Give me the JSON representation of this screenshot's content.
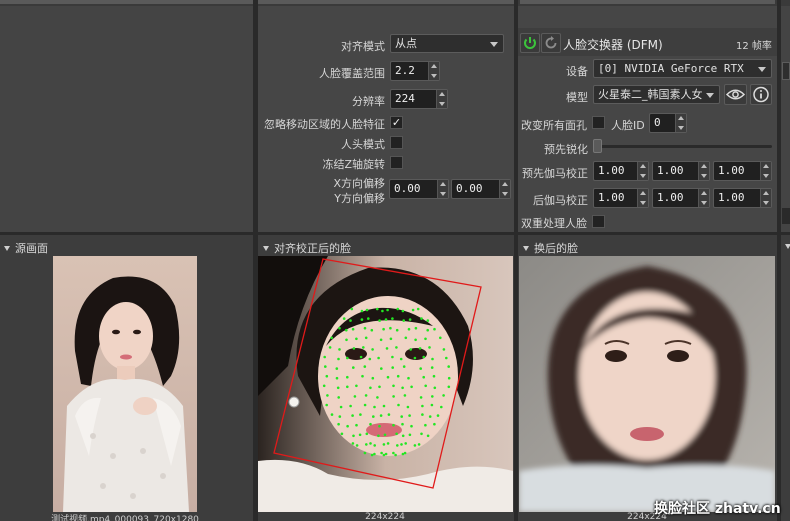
{
  "align_panel": {
    "align_mode_label": "对齐模式",
    "align_mode_value": "从点",
    "face_coverage_label": "人脸覆盖范围",
    "face_coverage_value": "2.2",
    "resolution_label": "分辨率",
    "resolution_value": "224",
    "ignore_moving_label": "忽略移动区域的人脸特征",
    "ignore_moving_checked": "✓",
    "head_mode_label": "人头模式",
    "freeze_z_label": "冻结Z轴旋转",
    "x_offset_label": "X方向偏移",
    "y_offset_label": "Y方向偏移",
    "x_offset_value": "0.00",
    "y_offset_value": "0.00"
  },
  "swapper_panel": {
    "title": "人脸交换器 (DFM)",
    "fps": "12 帧率",
    "device_label": "设备",
    "device_value": "[0] NVIDIA GeForce RTX",
    "model_label": "模型",
    "model_value": "火星泰二_韩国素人女",
    "swap_all_label": "改变所有面孔",
    "face_id_label": "人脸ID",
    "face_id_value": "0",
    "presharpen_label": "预先锐化",
    "pre_gamma_label": "预先伽马校正",
    "pre_gamma_values": [
      "1.00",
      "1.00",
      "1.00"
    ],
    "post_gamma_label": "后伽马校正",
    "post_gamma_values": [
      "1.00",
      "1.00",
      "1.00"
    ],
    "two_pass_label": "双重处理人脸"
  },
  "views": {
    "source_title": "源画面",
    "source_caption": "测试视频.mp4_000093_720x1280",
    "aligned_title": "对齐校正后的脸",
    "aligned_caption": "224x224",
    "swapped_title": "换后的脸",
    "swapped_caption": "224x224"
  },
  "watermark": "换脸社区 zhatv.cn",
  "colors": {
    "power_green": "#3cc43c",
    "landmark_green": "#22e622",
    "face_box_red": "#e01a1a"
  }
}
